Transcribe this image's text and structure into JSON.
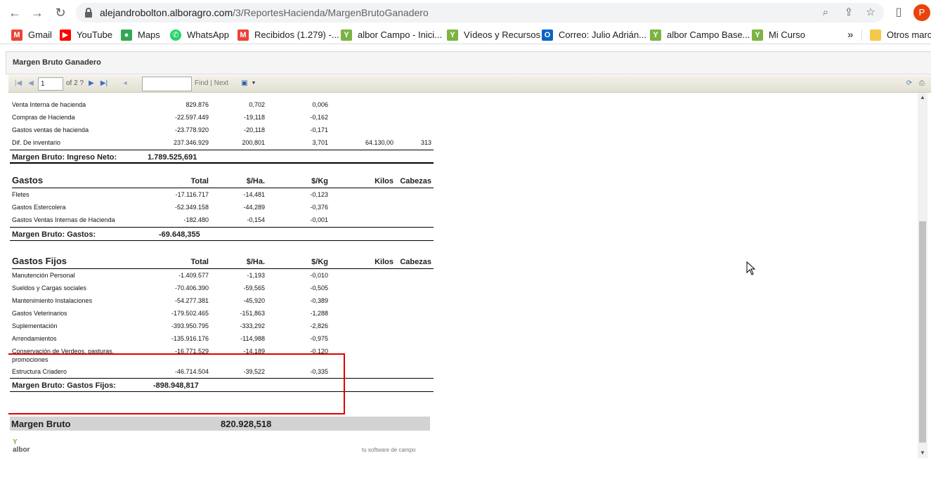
{
  "browser": {
    "url_host": "alejandrobolton.alboragro.com",
    "url_path": "/3/ReportesHacienda/MargenBrutoGanadero",
    "profile_initial": "P",
    "bookmarks": [
      {
        "label": "Gmail",
        "icon": "gmail-icon",
        "color": "#ea4335"
      },
      {
        "label": "YouTube",
        "icon": "youtube-icon",
        "color": "#ff0000"
      },
      {
        "label": "Maps",
        "icon": "maps-icon",
        "color": "#34a853"
      },
      {
        "label": "WhatsApp",
        "icon": "whatsapp-icon",
        "color": "#25d366"
      },
      {
        "label": "Recibidos (1.279) -...",
        "icon": "gmail-icon",
        "color": "#ea4335"
      },
      {
        "label": "albor Campo - Inici...",
        "icon": "albor-icon",
        "color": "#7cb342"
      },
      {
        "label": "Vídeos y Recursos",
        "icon": "albor-icon",
        "color": "#7cb342"
      },
      {
        "label": "Correo: Julio Adrián...",
        "icon": "outlook-icon",
        "color": "#0a64c8"
      },
      {
        "label": "albor Campo Base...",
        "icon": "albor-icon",
        "color": "#7cb342"
      },
      {
        "label": "Mi Curso",
        "icon": "albor-icon",
        "color": "#7cb342"
      }
    ],
    "more_label": "»",
    "other_bookmarks": "Otros marca"
  },
  "viewer": {
    "title": "Margen Bruto Ganadero",
    "page_number": "1",
    "of_label": "of 2 ?",
    "find_label": "Find | Next"
  },
  "report": {
    "ingresos_rows": [
      {
        "name": "Venta Interna de hacienda",
        "total": "829.876",
        "ha": "0,702",
        "kg": "0,006",
        "kilos": "",
        "cab": ""
      },
      {
        "name": "Compras de Hacienda",
        "total": "-22.597.449",
        "ha": "-19,118",
        "kg": "-0,162",
        "kilos": "",
        "cab": ""
      },
      {
        "name": "Gastos ventas de hacienda",
        "total": "-23.778.920",
        "ha": "-20,118",
        "kg": "-0,171",
        "kilos": "",
        "cab": ""
      },
      {
        "name": "Dif. De inventario",
        "total": "237.346.929",
        "ha": "200,801",
        "kg": "3,701",
        "kilos": "64.130,00",
        "cab": "313"
      }
    ],
    "ingreso_neto": {
      "label": "Margen Bruto: Ingreso Neto:",
      "value": "1.789.525,691"
    },
    "headers": {
      "total": "Total",
      "ha": "$/Ha.",
      "kg": "$/Kg",
      "kilos": "Kilos",
      "cab": "Cabezas"
    },
    "gastos": {
      "title": "Gastos",
      "rows": [
        {
          "name": "Fletes",
          "total": "-17.116.717",
          "ha": "-14,481",
          "kg": "-0,123"
        },
        {
          "name": "Gastos Estercolera",
          "total": "-52.349.158",
          "ha": "-44,289",
          "kg": "-0,376"
        },
        {
          "name": "Gastos Ventas Internas de Hacienda",
          "total": "-182.480",
          "ha": "-0,154",
          "kg": "-0,001"
        }
      ],
      "sum_label": "Margen Bruto: Gastos:",
      "sum_value": "-69.648,355"
    },
    "gastos_fijos": {
      "title": "Gastos Fijos",
      "rows": [
        {
          "name": "Manutención Personal",
          "total": "-1.409.577",
          "ha": "-1,193",
          "kg": "-0,010"
        },
        {
          "name": "Sueldos y Cargas sociales",
          "total": "-70.406.390",
          "ha": "-59,565",
          "kg": "-0,505"
        },
        {
          "name": "Mantenimiento Instalaciones",
          "total": "-54.277.381",
          "ha": "-45,920",
          "kg": "-0,389"
        },
        {
          "name": "Gastos Veterinarios",
          "total": "-179.502.465",
          "ha": "-151,863",
          "kg": "-1,288"
        },
        {
          "name": "Suplementación",
          "total": "-393.950.795",
          "ha": "-333,292",
          "kg": "-2,826"
        },
        {
          "name": "Arrendamientos",
          "total": "-135.916.176",
          "ha": "-114,988",
          "kg": "-0,975"
        },
        {
          "name": "Conservación de Verdeos, pasturas,",
          "name2": "promociones",
          "total": "-16.771.529",
          "ha": "-14,189",
          "kg": "-0,120"
        },
        {
          "name": "Estructura Criadero",
          "total": "-46.714.504",
          "ha": "-39,522",
          "kg": "-0,335"
        }
      ],
      "sum_label": "Margen Bruto: Gastos Fijos:",
      "sum_value": "-898.948,817"
    },
    "margen_bruto": {
      "label": "Margen Bruto",
      "value": "820.928,518"
    },
    "footer_logo": "albor",
    "footer_tagline": "tu software de campo"
  },
  "colors": {
    "highlight": "#e00000",
    "profile": "#e8430a"
  }
}
